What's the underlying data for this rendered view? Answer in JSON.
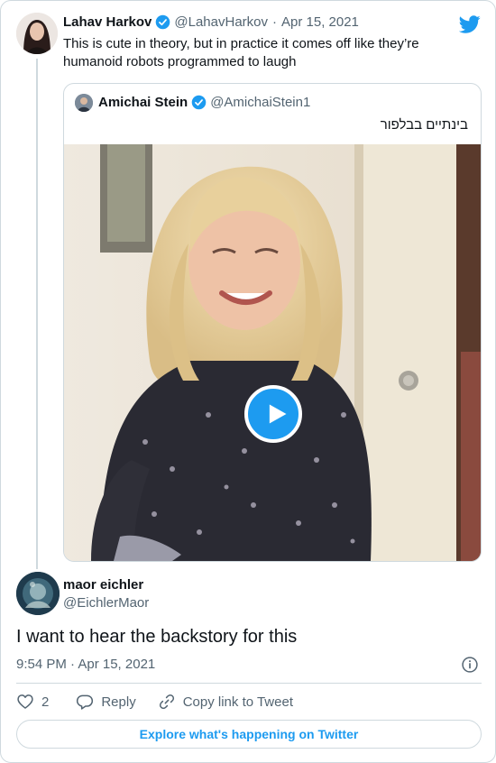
{
  "tweet": {
    "author_name": "Lahav Harkov",
    "author_handle": "@LahavHarkov",
    "separator": "·",
    "date": "Apr 15, 2021",
    "text": "This is cute in theory, but in practice it comes off like they’re humanoid robots programmed to laugh"
  },
  "quoted_tweet": {
    "author_name": "Amichai Stein",
    "author_handle": "@AmichaiStein1",
    "text": "בינתיים בבלפור"
  },
  "reply": {
    "author_name": "maor eichler",
    "author_handle": "@EichlerMaor",
    "text": "I want to hear the backstory for this",
    "timestamp": "9:54 PM · Apr 15, 2021"
  },
  "actions": {
    "like_count": "2",
    "reply_label": "Reply",
    "copy_link_label": "Copy link to Tweet"
  },
  "explore_label": "Explore what's happening on Twitter",
  "icons": {
    "brand": "twitter-bird-icon",
    "verified": "verified-badge-icon",
    "play": "play-icon",
    "info": "info-icon",
    "like": "heart-icon",
    "reply": "reply-bubble-icon",
    "copy_link": "link-icon"
  },
  "colors": {
    "accent": "#1d9bf0",
    "text_primary": "#0f1419",
    "text_secondary": "#536471",
    "border": "#cfd9de"
  }
}
